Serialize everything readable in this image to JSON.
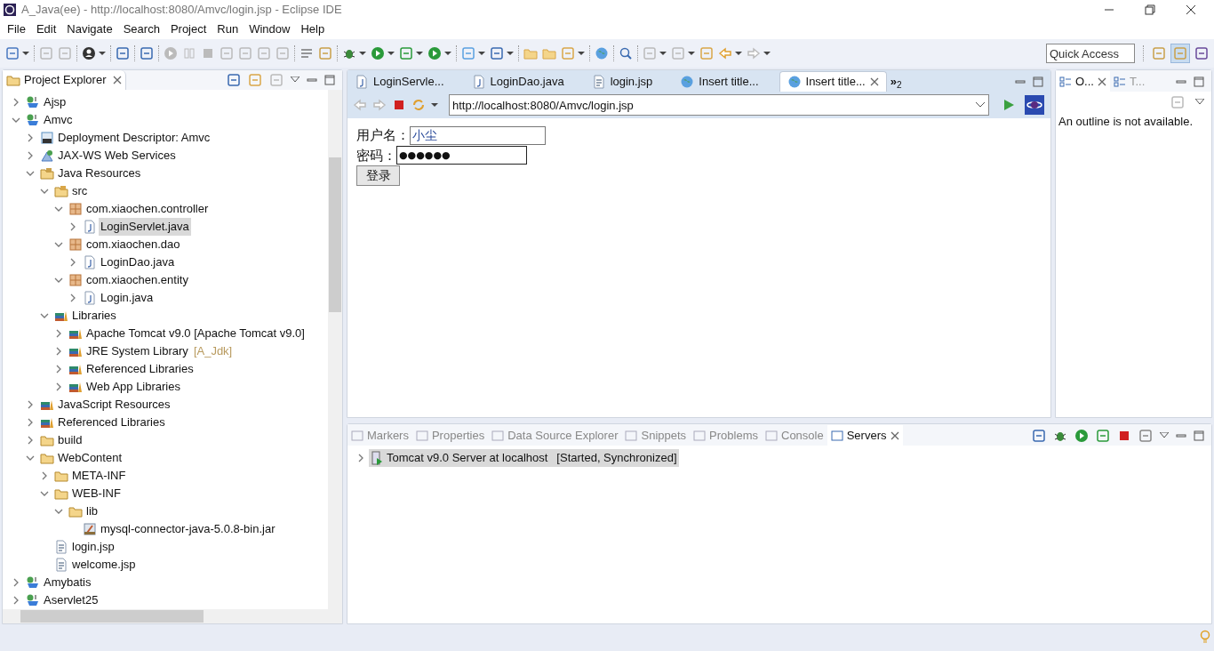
{
  "window": {
    "title": "A_Java(ee) - http://localhost:8080/Amvc/login.jsp - Eclipse IDE"
  },
  "menu": [
    "File",
    "Edit",
    "Navigate",
    "Search",
    "Project",
    "Run",
    "Window",
    "Help"
  ],
  "quick_access": {
    "placeholder": "Quick Access"
  },
  "project_explorer": {
    "title": "Project Explorer",
    "tree": [
      {
        "label": "Ajsp",
        "kind": "project",
        "expanded": false,
        "selected": false
      },
      {
        "label": "Amvc",
        "kind": "project",
        "expanded": true,
        "selected": false,
        "children": [
          {
            "label": "Deployment Descriptor: Amvc",
            "kind": "descriptor",
            "expanded": false,
            "selected": false
          },
          {
            "label": "JAX-WS Web Services",
            "kind": "webservice",
            "expanded": false,
            "selected": false
          },
          {
            "label": "Java Resources",
            "kind": "javares",
            "expanded": true,
            "selected": false,
            "children": [
              {
                "label": "src",
                "kind": "srcfolder",
                "expanded": true,
                "selected": false,
                "children": [
                  {
                    "label": "com.xiaochen.controller",
                    "kind": "package",
                    "expanded": true,
                    "selected": false,
                    "children": [
                      {
                        "label": "LoginServlet.java",
                        "kind": "java",
                        "expanded": false,
                        "selected": true
                      }
                    ]
                  },
                  {
                    "label": "com.xiaochen.dao",
                    "kind": "package",
                    "expanded": true,
                    "selected": false,
                    "children": [
                      {
                        "label": "LoginDao.java",
                        "kind": "java",
                        "expanded": false,
                        "selected": false
                      }
                    ]
                  },
                  {
                    "label": "com.xiaochen.entity",
                    "kind": "package",
                    "expanded": true,
                    "selected": false,
                    "children": [
                      {
                        "label": "Login.java",
                        "kind": "java",
                        "expanded": false,
                        "selected": false
                      }
                    ]
                  }
                ]
              },
              {
                "label": "Libraries",
                "kind": "library",
                "expanded": true,
                "selected": false,
                "children": [
                  {
                    "label": "Apache Tomcat v9.0 [Apache Tomcat v9.0]",
                    "kind": "library",
                    "expanded": false,
                    "selected": false
                  },
                  {
                    "label": "JRE System Library",
                    "decoration": "[A_Jdk]",
                    "kind": "library",
                    "expanded": false,
                    "selected": false
                  },
                  {
                    "label": "Referenced Libraries",
                    "kind": "library",
                    "expanded": false,
                    "selected": false
                  },
                  {
                    "label": "Web App Libraries",
                    "kind": "library",
                    "expanded": false,
                    "selected": false
                  }
                ]
              }
            ]
          },
          {
            "label": "JavaScript Resources",
            "kind": "library",
            "expanded": false,
            "selected": false
          },
          {
            "label": "Referenced Libraries",
            "kind": "library",
            "expanded": false,
            "selected": false
          },
          {
            "label": "build",
            "kind": "folder",
            "expanded": false,
            "selected": false
          },
          {
            "label": "WebContent",
            "kind": "folder",
            "expanded": true,
            "selected": false,
            "children": [
              {
                "label": "META-INF",
                "kind": "folder",
                "expanded": false,
                "selected": false
              },
              {
                "label": "WEB-INF",
                "kind": "folder",
                "expanded": true,
                "selected": false,
                "children": [
                  {
                    "label": "lib",
                    "kind": "folder",
                    "expanded": true,
                    "selected": false,
                    "children": [
                      {
                        "label": "mysql-connector-java-5.0.8-bin.jar",
                        "kind": "jar",
                        "selected": false
                      }
                    ]
                  }
                ]
              },
              {
                "label": "login.jsp",
                "kind": "file",
                "selected": false
              },
              {
                "label": "welcome.jsp",
                "kind": "file",
                "selected": false
              }
            ]
          }
        ]
      },
      {
        "label": "Amybatis",
        "kind": "project",
        "expanded": false,
        "selected": false
      },
      {
        "label": "Aservlet25",
        "kind": "project",
        "expanded": false,
        "selected": false
      }
    ]
  },
  "editor": {
    "tabs": [
      {
        "label": "LoginServle...",
        "kind": "java",
        "selected": false
      },
      {
        "label": "LoginDao.java",
        "kind": "java",
        "selected": false
      },
      {
        "label": "login.jsp",
        "kind": "file",
        "selected": false
      },
      {
        "label": "Insert title...",
        "kind": "globe",
        "selected": false
      },
      {
        "label": "Insert title...",
        "kind": "globe",
        "selected": true
      }
    ],
    "overflow": "»",
    "overflow_count": "2",
    "address": "http://localhost:8080/Amvc/login.jsp",
    "page": {
      "username_label": "用户名：",
      "username": "小尘",
      "password_label": "密码：",
      "password": "●●●●●●",
      "submit": "登录"
    }
  },
  "outline": {
    "tabs": [
      {
        "label": "O...",
        "selected": true
      },
      {
        "label": "T...",
        "selected": false
      }
    ],
    "message": "An outline is not available."
  },
  "bottom": {
    "tabs": [
      {
        "label": "Markers",
        "selected": false
      },
      {
        "label": "Properties",
        "selected": false
      },
      {
        "label": "Data Source Explorer",
        "selected": false
      },
      {
        "label": "Snippets",
        "selected": false
      },
      {
        "label": "Problems",
        "selected": false
      },
      {
        "label": "Console",
        "selected": false
      },
      {
        "label": "Servers",
        "selected": true
      }
    ],
    "servers": [
      {
        "name": "Tomcat v9.0 Server at localhost",
        "status": "[Started, Synchronized]",
        "expanded": false,
        "selected": true
      }
    ]
  }
}
